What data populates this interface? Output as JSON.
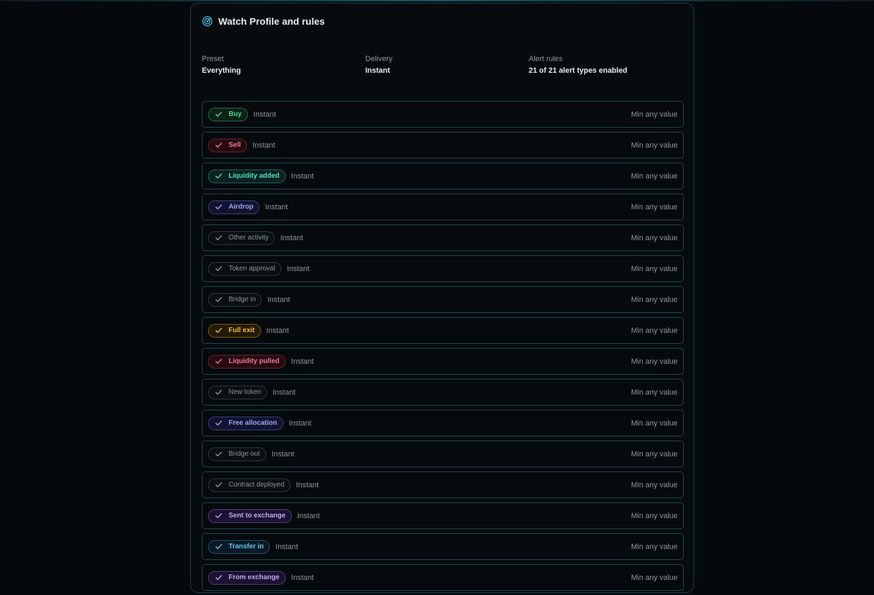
{
  "panel": {
    "title": "Watch Profile and rules",
    "icon": "radar-icon"
  },
  "summary": {
    "preset_label": "Preset",
    "preset_value": "Everything",
    "delivery_label": "Delivery",
    "delivery_value": "Instant",
    "rules_label": "Alert rules",
    "rules_value": "21 of 21 alert types enabled"
  },
  "colors": {
    "green": "#4fd68a",
    "red": "#f27a8c",
    "teal": "#52e0c5",
    "indigo": "#9ba5f5",
    "amber": "#f2bf3d",
    "blue": "#6ec3ef",
    "violet": "#c4a7f7",
    "muted": "#8a969a",
    "border": "#1b4852"
  },
  "rules": [
    {
      "label": "Buy",
      "tone": "green",
      "delivery": "Instant",
      "min": "Min any value"
    },
    {
      "label": "Sell",
      "tone": "red",
      "delivery": "Instant",
      "min": "Min any value"
    },
    {
      "label": "Liquidity added",
      "tone": "teal",
      "delivery": "Instant",
      "min": "Min any value"
    },
    {
      "label": "Airdrop",
      "tone": "indigo",
      "delivery": "Instant",
      "min": "Min any value"
    },
    {
      "label": "Other activity",
      "tone": "muted",
      "delivery": "Instant",
      "min": "Min any value"
    },
    {
      "label": "Token approval",
      "tone": "muted",
      "delivery": "Instant",
      "min": "Min any value"
    },
    {
      "label": "Bridge in",
      "tone": "muted",
      "delivery": "Instant",
      "min": "Min any value"
    },
    {
      "label": "Full exit",
      "tone": "amber",
      "delivery": "Instant",
      "min": "Min any value"
    },
    {
      "label": "Liquidity pulled",
      "tone": "red",
      "delivery": "Instant",
      "min": "Min any value"
    },
    {
      "label": "New token",
      "tone": "muted",
      "delivery": "Instant",
      "min": "Min any value"
    },
    {
      "label": "Free allocation",
      "tone": "indigo",
      "delivery": "Instant",
      "min": "Min any value"
    },
    {
      "label": "Bridge out",
      "tone": "muted",
      "delivery": "Instant",
      "min": "Min any value"
    },
    {
      "label": "Contract deployed",
      "tone": "muted",
      "delivery": "Instant",
      "min": "Min any value"
    },
    {
      "label": "Sent to exchange",
      "tone": "violet",
      "delivery": "Instant",
      "min": "Min any value"
    },
    {
      "label": "Transfer in",
      "tone": "blue",
      "delivery": "Instant",
      "min": "Min any value"
    },
    {
      "label": "From exchange",
      "tone": "violet",
      "delivery": "Instant",
      "min": "Min any value"
    }
  ]
}
